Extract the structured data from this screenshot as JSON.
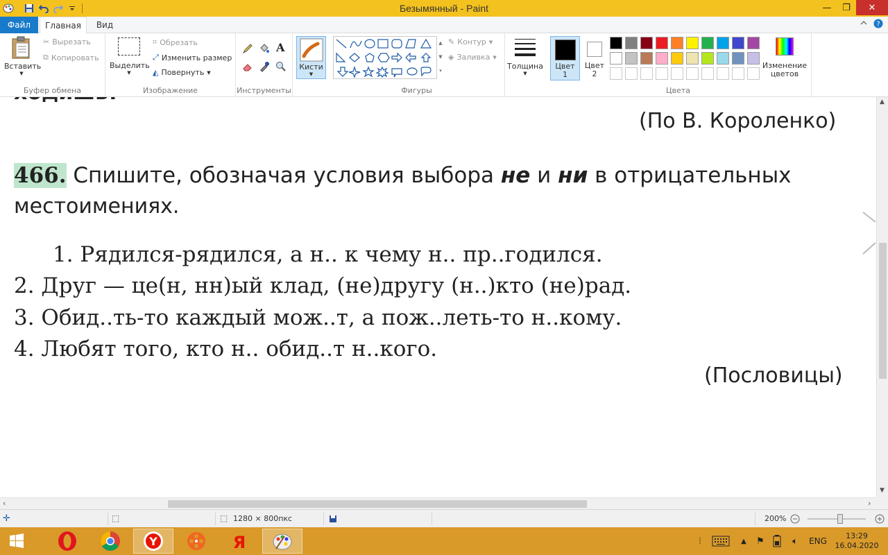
{
  "window": {
    "title": "Безымянный - Paint",
    "minimize": "—",
    "maximize": "❐",
    "close": "✕"
  },
  "tabs": {
    "file": "Файл",
    "home": "Главная",
    "view": "Вид"
  },
  "ribbon": {
    "clipboard": {
      "label": "Буфер обмена",
      "paste": "Вставить",
      "cut": "Вырезать",
      "copy": "Копировать"
    },
    "image": {
      "label": "Изображение",
      "select": "Выделить",
      "crop": "Обрезать",
      "resize": "Изменить размер",
      "rotate": "Повернуть"
    },
    "tools": {
      "label": "Инструменты"
    },
    "brushes": {
      "label": "Кисти"
    },
    "shapes": {
      "label": "Фигуры",
      "outline": "Контур",
      "fill": "Заливка"
    },
    "size": {
      "label": "Толщина"
    },
    "color1": {
      "label1": "Цвет",
      "label2": "1"
    },
    "color2": {
      "label1": "Цвет",
      "label2": "2"
    },
    "colors": {
      "label": "Цвета",
      "edit1": "Изменение",
      "edit2": "цветов",
      "palette_row1": [
        "#000000",
        "#7f7f7f",
        "#880015",
        "#ed1c24",
        "#ff7f27",
        "#fff200",
        "#22b14c",
        "#00a2e8",
        "#3f48cc",
        "#a349a4"
      ],
      "palette_row2": [
        "#ffffff",
        "#c3c3c3",
        "#b97a57",
        "#ffaec9",
        "#ffc90e",
        "#efe4b0",
        "#b5e61d",
        "#99d9ea",
        "#7092be",
        "#c8bfe7"
      ]
    }
  },
  "canvas": {
    "prev_line": "ходишь!",
    "attribution1": "(По  В. Короленко)",
    "task_number": "466.",
    "task_l1_a": " Спишите,  обозначая  условия  выбора ",
    "task_ne": "не",
    "task_l1_b": " и ",
    "task_ni": "ни",
    "task_l1_c": " в  отрицательных",
    "task_l2": "местоимениях.",
    "p1": "1.  Рядился-рядился,  а  н..  к  чему  н..  пр..годился.",
    "p2": "2.  Друг — це(н, нн)ый  клад,  (не)другу  (н..)кто  (не)рад.",
    "p3": "3.  Обид..ть-то  каждый  мож..т,  а  пож..леть-то  н..кому.",
    "p4": "4.  Любят  того,  кто  н..  обид..т  н..кого.",
    "attribution2": "(Пословицы)"
  },
  "status": {
    "size": "1280 × 800пкс",
    "zoom": "200%"
  },
  "taskbar": {
    "lang": "ENG",
    "time": "13:29",
    "date": "16.04.2020"
  }
}
